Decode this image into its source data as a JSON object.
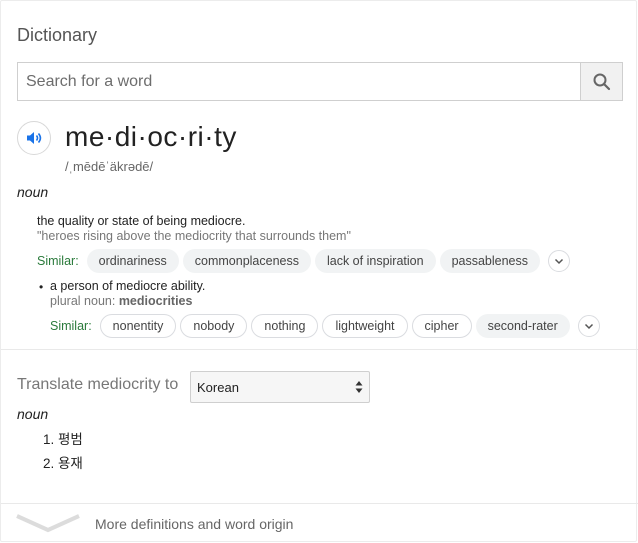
{
  "card": {
    "title": "Dictionary",
    "search": {
      "placeholder": "Search for a word",
      "value": ""
    },
    "entry": {
      "word": "me·di·oc·ri·ty",
      "phonetic": "/ˌmēdēˈäkrədē/",
      "part_of_speech": "noun",
      "senses": [
        {
          "definition": "the quality or state of being mediocre.",
          "example": "\"heroes rising above the mediocrity that surrounds them\"",
          "similar_label": "Similar:",
          "similar": [
            "ordinariness",
            "commonplaceness",
            "lack of inspiration",
            "passableness"
          ]
        },
        {
          "definition": "a person of mediocre ability.",
          "plural_prefix": "plural noun:",
          "plural": "mediocrities",
          "similar_label": "Similar:",
          "similar": [
            "nonentity",
            "nobody",
            "nothing",
            "lightweight",
            "cipher",
            "second-rater"
          ]
        }
      ]
    },
    "translate": {
      "label": "Translate mediocrity to",
      "language": "Korean",
      "part_of_speech": "noun",
      "items": [
        "1. 평범",
        "2. 용재"
      ]
    },
    "footer": {
      "more_label": "More definitions and word origin"
    }
  },
  "icons": {
    "search": "search-icon",
    "speaker": "speaker-icon",
    "expand": "chevron-down-icon",
    "select_arrows": "updown-arrows-icon",
    "more": "chevron-down-icon"
  },
  "colors": {
    "speaker_blue": "#1a73e8",
    "similar_green": "#2a7a3b"
  }
}
